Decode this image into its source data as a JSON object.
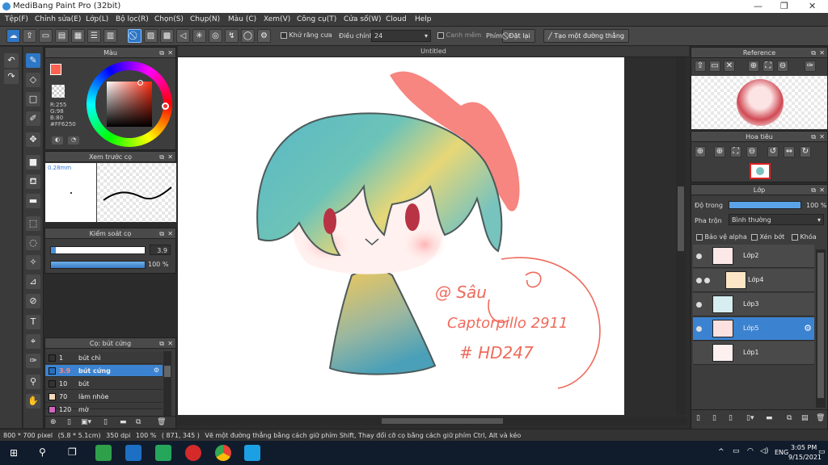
{
  "window": {
    "title": "MediBang Paint Pro (32bit)",
    "minimize": "—",
    "maximize": "❐",
    "close": "✕"
  },
  "menu": [
    "Tệp(F)",
    "Chỉnh sửa(E)",
    "Lớp(L)",
    "Bộ lọc(R)",
    "Chọn(S)",
    "Chụp(N)",
    "Màu (C)",
    "Xem(V)",
    "Công cụ(T)",
    "Cửa số(W)",
    "Cloud",
    "Help"
  ],
  "toolbar": {
    "antialias_label": "Khử răng cưa",
    "adjust_label": "Điều chỉnh",
    "adjust_value": "24",
    "snap_label": "Canh mềm",
    "key_label": "Phím",
    "reset_label": "Đặt lại",
    "newline_label": "Tạo một đường thẳng"
  },
  "color_panel": {
    "title": "Màu",
    "r": "R:255",
    "g": "G:98",
    "b": "B:80",
    "hex": "#FF6250",
    "primary_color": "#FF6250"
  },
  "brush_preview": {
    "title": "Xem trước cọ",
    "size": "0.28mm"
  },
  "brush_control": {
    "title": "Kiểm soát cọ",
    "size_value": "3.9",
    "opacity_value": "100 %",
    "size_fraction": 0.05,
    "opacity_fraction": 1.0
  },
  "brush_panel": {
    "title": "Cọ: bút cứng",
    "rows": [
      {
        "size": "1",
        "name": "bút chì",
        "color": "#333333"
      },
      {
        "size": "3.9",
        "name": "bút cứng",
        "color": "#2a6fb8"
      },
      {
        "size": "10",
        "name": "bút",
        "color": "#333333"
      },
      {
        "size": "70",
        "name": "làm nhòe",
        "color": "#f5d8b8"
      },
      {
        "size": "120",
        "name": "mờ",
        "color": "#d066c0"
      }
    ]
  },
  "canvas": {
    "title": "Untitled"
  },
  "artwork": {
    "signature_line1": "@ Sâu",
    "signature_line2": "Captorpillo 2911",
    "signature_line3": "# HD247",
    "signature_color": "#ef6a5c"
  },
  "reference_panel": {
    "title": "Reference"
  },
  "navigator_panel": {
    "title": "Hoa tiêu"
  },
  "layer_panel": {
    "title": "Lớp",
    "opacity_label": "Độ trong",
    "opacity_value": "100 %",
    "blend_label": "Pha trộn",
    "blend_value": "Bình thường",
    "protect_alpha": "Bảo vệ alpha",
    "clipping": "Xén bớt",
    "lock": "Khóa",
    "layers": [
      {
        "name": "Lớp2"
      },
      {
        "name": "Lớp4"
      },
      {
        "name": "Lớp3"
      },
      {
        "name": "Lớp5"
      },
      {
        "name": "Lớp1"
      }
    ]
  },
  "status": {
    "size": "800 * 700 pixel",
    "cm": "(5.8 * 5.1cm)",
    "dpi": "350 dpi",
    "zoom": "100 %",
    "coords": "( 871, 345 )",
    "hint": "Vẽ một đường thẳng bằng cách giữ phím Shift, Thay đổi cỡ cọ bằng cách giữ phím Ctrl, Alt và kéo"
  },
  "taskbar": {
    "lang": "ENG",
    "time": "3:05 PM",
    "date": "9/15/2021",
    "chevron": "^"
  }
}
